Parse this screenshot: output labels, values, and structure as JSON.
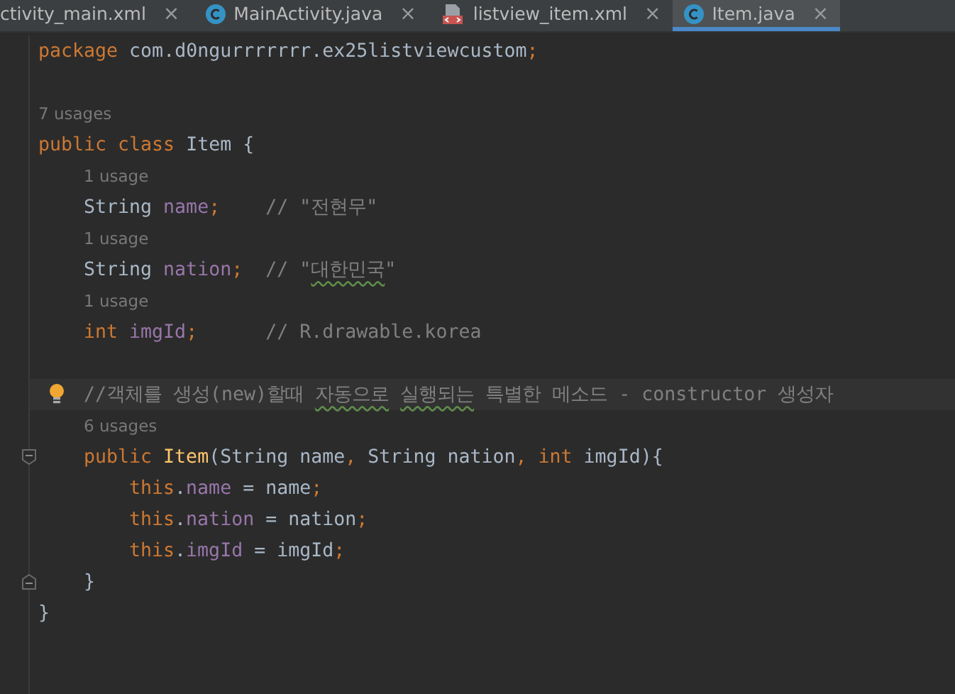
{
  "tabs": [
    {
      "label": "ctivity_main.xml",
      "close": "×",
      "selected": false
    },
    {
      "label": "MainActivity.java",
      "kind": "java",
      "close": "×",
      "selected": false
    },
    {
      "label": "listview_item.xml",
      "kind": "layout",
      "close": "×",
      "selected": false
    },
    {
      "label": "Item.java",
      "kind": "java",
      "close": "×",
      "selected": true
    }
  ],
  "lines": [
    {
      "kind": "code",
      "tokens": [
        {
          "kind": "keyword",
          "text": "package "
        },
        {
          "kind": "plain",
          "text": "com.d0ngurrrrrrr.ex25listviewcustom"
        },
        {
          "kind": "keyword",
          "text": ";"
        }
      ]
    },
    {
      "kind": "blank"
    },
    {
      "kind": "usage",
      "text": "7 usages"
    },
    {
      "kind": "code",
      "tokens": [
        {
          "kind": "keyword",
          "text": "public class "
        },
        {
          "kind": "plain",
          "text": "Item {"
        }
      ],
      "children": [
        {
          "kind": "usage",
          "text": "1 usage"
        },
        {
          "kind": "code",
          "tokens": [
            {
              "kind": "plain",
              "text": "String "
            },
            {
              "kind": "field",
              "text": "name"
            },
            {
              "kind": "keyword",
              "text": ";"
            },
            {
              "kind": "comment",
              "text": "    // \"전현무\""
            }
          ]
        },
        {
          "kind": "usage",
          "text": "1 usage"
        },
        {
          "kind": "code",
          "tokens": [
            {
              "kind": "plain",
              "text": "String "
            },
            {
              "kind": "field",
              "text": "nation"
            },
            {
              "kind": "keyword",
              "text": ";"
            },
            {
              "kind": "comment",
              "text": "  // \""
            },
            {
              "kind": "comment",
              "text": "대한민국",
              "typo": true
            },
            {
              "kind": "comment",
              "text": "\""
            }
          ]
        },
        {
          "kind": "usage",
          "text": "1 usage"
        },
        {
          "kind": "code",
          "tokens": [
            {
              "kind": "keyword",
              "text": "int "
            },
            {
              "kind": "field",
              "text": "imgId"
            },
            {
              "kind": "keyword",
              "text": ";"
            },
            {
              "kind": "comment",
              "text": "      // R.drawable.korea"
            }
          ]
        },
        {
          "kind": "blank"
        },
        {
          "kind": "code",
          "current": true,
          "bulb": true,
          "tokens": [
            {
              "kind": "comment",
              "text": "//객체를 생성(new)할때 "
            },
            {
              "kind": "comment",
              "text": "자동으로",
              "typo": true
            },
            {
              "kind": "comment",
              "text": "실행되는",
              "typo": true
            },
            {
              "kind": "comment",
              "text": " 특별한 메소드 - constructor 생성자"
            }
          ]
        },
        {
          "kind": "usage",
          "text": "6 usages"
        },
        {
          "kind": "code",
          "fold": true,
          "tokens": [
            {
              "kind": "keyword",
              "text": "public "
            },
            {
              "kind": "method",
              "text": "Item"
            },
            {
              "kind": "plain",
              "text": "(String name"
            },
            {
              "kind": "keyword",
              "text": ", "
            },
            {
              "kind": "plain",
              "text": "String nation"
            },
            {
              "kind": "keyword",
              "text": ", int "
            },
            {
              "kind": "plain",
              "text": "imgId){"
            }
          ],
          "children": [
            {
              "kind": "code",
              "tokens": [
                {
                  "kind": "keyword",
                  "text": "this"
                },
                {
                  "kind": "plain",
                  "text": "."
                },
                {
                  "kind": "field",
                  "text": "name"
                },
                {
                  "kind": "plain",
                  "text": " = name"
                },
                {
                  "kind": "keyword",
                  "text": ";"
                }
              ]
            },
            {
              "kind": "code",
              "tokens": [
                {
                  "kind": "keyword",
                  "text": "this"
                },
                {
                  "kind": "plain",
                  "text": "."
                },
                {
                  "kind": "field",
                  "text": "nation"
                },
                {
                  "kind": "plain",
                  "text": " = nation"
                },
                {
                  "kind": "keyword",
                  "text": ";"
                }
              ]
            },
            {
              "kind": "code",
              "tokens": [
                {
                  "kind": "keyword",
                  "text": "this"
                },
                {
                  "kind": "plain",
                  "text": "."
                },
                {
                  "kind": "field",
                  "text": "imgId"
                },
                {
                  "kind": "plain",
                  "text": " = imgId"
                },
                {
                  "kind": "keyword",
                  "text": ";"
                }
              ]
            }
          ],
          "closing": [
            {
              "kind": "plain",
              "text": "}"
            }
          ]
        }
      ],
      "closing": [
        {
          "kind": "plain",
          "text": "}"
        }
      ]
    }
  ]
}
